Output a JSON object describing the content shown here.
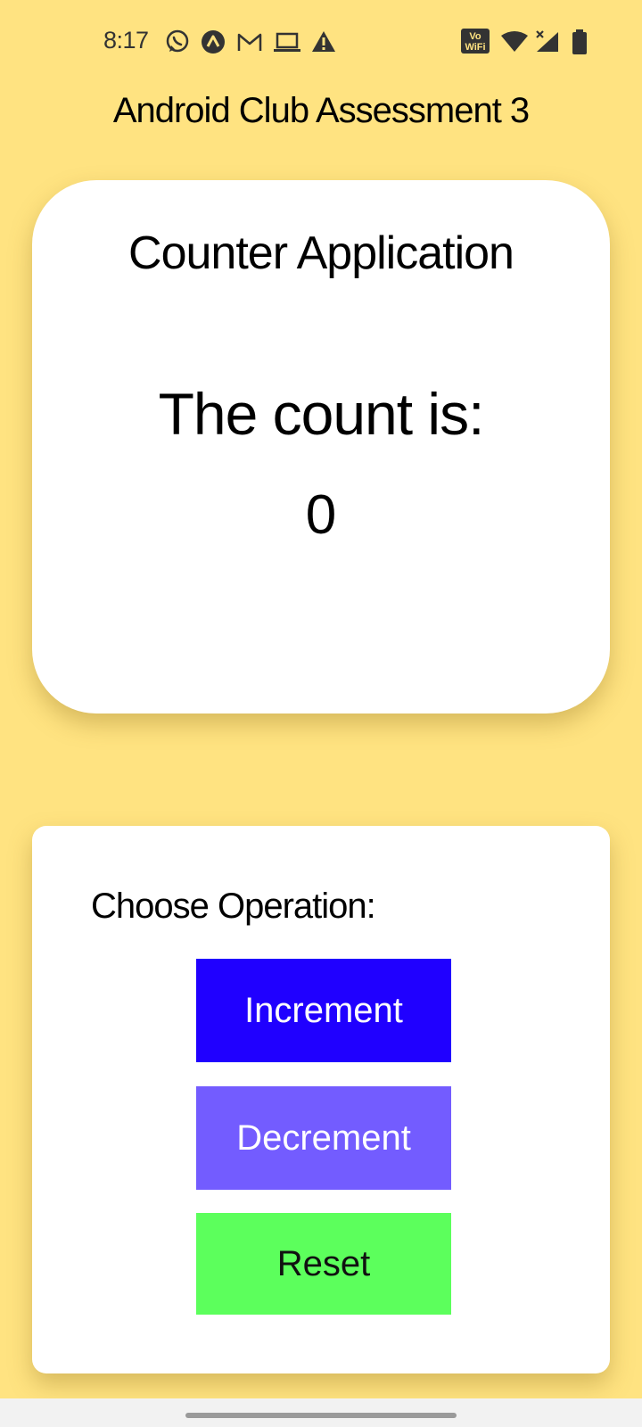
{
  "status_bar": {
    "time": "8:17",
    "vowifi_line1": "Vo",
    "vowifi_line2": "WiFi",
    "left_icons": [
      "whatsapp-icon",
      "app-icon",
      "gmail-icon",
      "laptop-icon",
      "warning-icon"
    ],
    "right_icons": [
      "vowifi-icon",
      "wifi-icon",
      "cell-signal-icon",
      "battery-icon"
    ]
  },
  "app": {
    "title": "Android Club Assessment 3"
  },
  "counter_card": {
    "title": "Counter Application",
    "count_label": "The count is:",
    "count_value": "0"
  },
  "operations_card": {
    "label": "Choose Operation:",
    "increment_label": "Increment",
    "decrement_label": "Decrement",
    "reset_label": "Reset"
  },
  "colors": {
    "background": "#FFE381",
    "increment": "#2000FF",
    "decrement": "#735CFF",
    "reset": "#5CFF5C"
  }
}
